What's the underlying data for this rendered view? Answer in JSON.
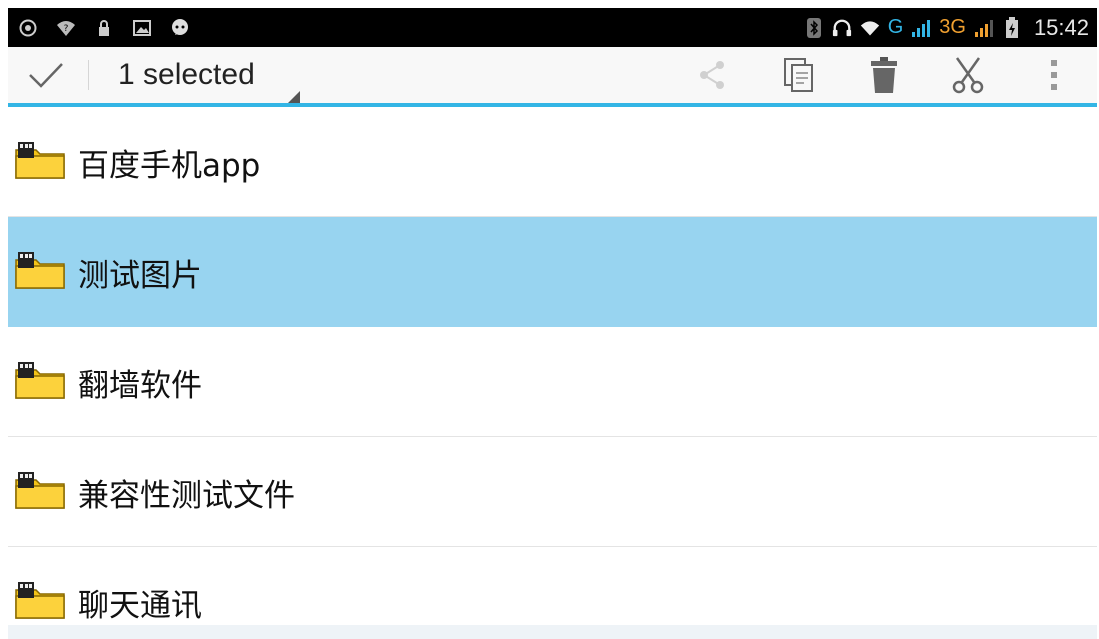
{
  "status_bar": {
    "left_icons": [
      "whatsapp-icon",
      "wifi-question-icon",
      "lock-icon",
      "image-icon",
      "chat-bubble-icon"
    ],
    "right_icons": [
      "bluetooth-icon",
      "headset-icon",
      "wifi-icon"
    ],
    "network_g": "G",
    "network_3g": "3G",
    "time": "15:42"
  },
  "action_bar": {
    "done_icon": "check-icon",
    "selected_label": "1 selected",
    "actions": [
      {
        "name": "share",
        "icon": "share-icon"
      },
      {
        "name": "copy",
        "icon": "copy-icon"
      },
      {
        "name": "delete",
        "icon": "trash-icon"
      },
      {
        "name": "cut",
        "icon": "scissors-icon"
      },
      {
        "name": "overflow",
        "icon": "more-vert-icon"
      }
    ]
  },
  "files": [
    {
      "name": "百度手机app",
      "selected": false
    },
    {
      "name": "测试图片",
      "selected": true
    },
    {
      "name": "翻墙软件",
      "selected": false
    },
    {
      "name": "兼容性测试文件",
      "selected": false
    },
    {
      "name": "聊天通讯",
      "selected": false
    }
  ],
  "colors": {
    "accent": "#33b5e5",
    "selected_row": "#98d4f0",
    "folder": "#f5c518"
  }
}
